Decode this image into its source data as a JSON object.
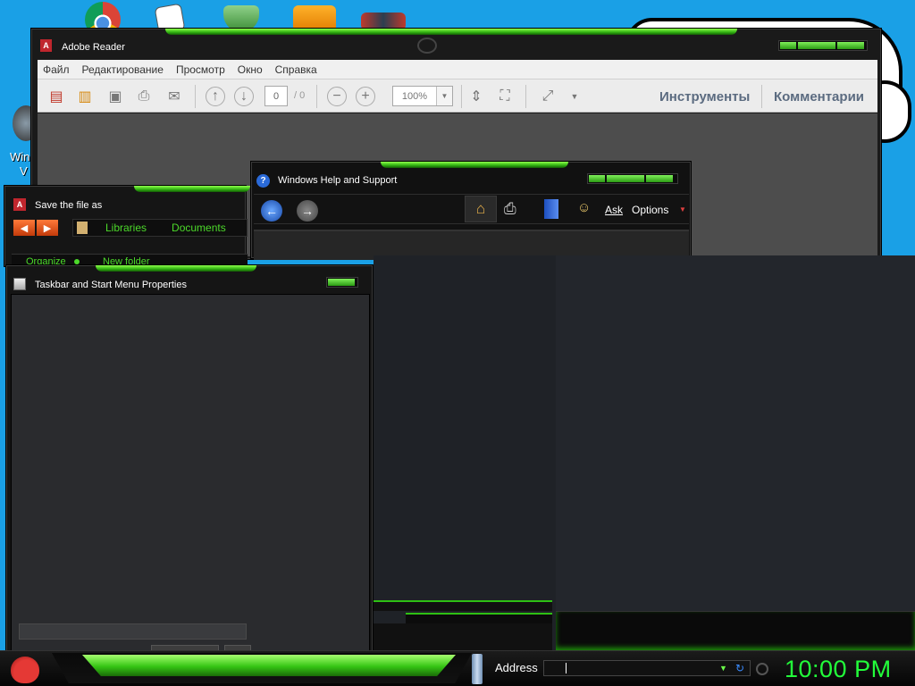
{
  "desktop": {
    "icon_label_line1": "Win",
    "icon_label_line2": "V"
  },
  "reader": {
    "title": "Adobe Reader",
    "menu": [
      "Файл",
      "Редактирование",
      "Просмотр",
      "Окно",
      "Справка"
    ],
    "page_current": "0",
    "page_total": "/ 0",
    "zoom": "100%",
    "tools_link": "Инструменты",
    "comments_link": "Комментарии"
  },
  "help": {
    "title": "Windows Help and Support",
    "ask": "Ask",
    "options": "Options"
  },
  "save_dialog": {
    "title": "Save the file as",
    "crumb_libraries": "Libraries",
    "crumb_documents": "Documents",
    "organize": "Organize",
    "new_folder": "New folder"
  },
  "taskbar_props": {
    "title": "Taskbar and Start Menu Properties"
  },
  "taskbar": {
    "address_label": "Address",
    "clock": "10:00 PM"
  },
  "colors": {
    "accent_green": "#3fd11a",
    "desktop_blue": "#1aa0e6",
    "clock_green": "#22ff3a"
  }
}
